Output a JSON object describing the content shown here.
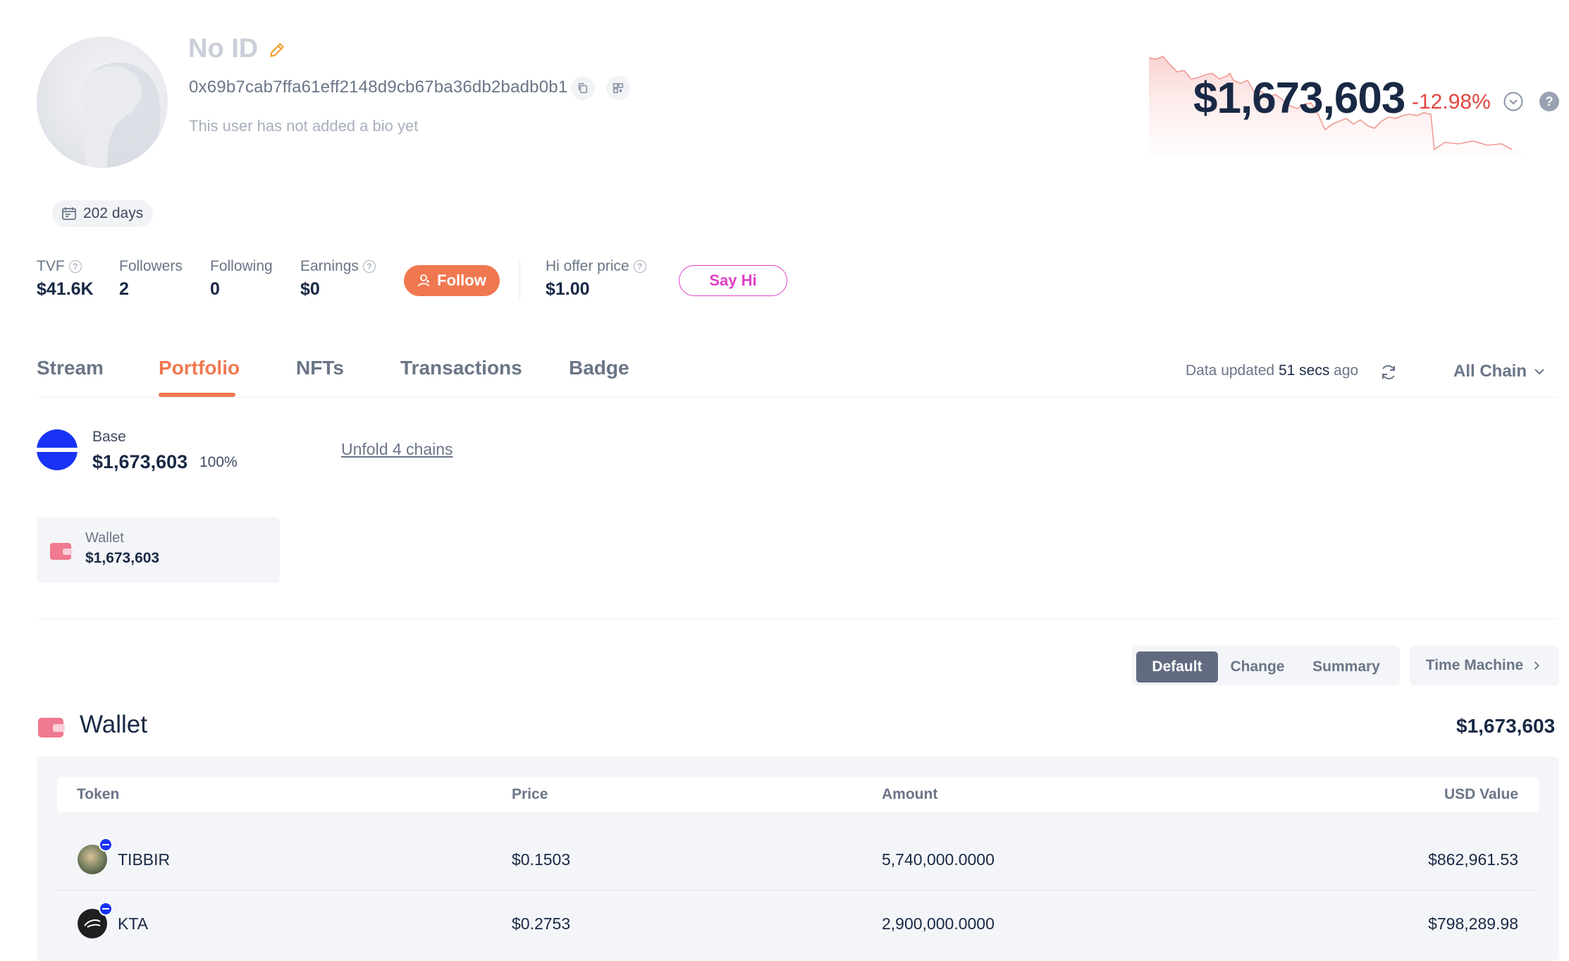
{
  "profile": {
    "name": "No ID",
    "address": "0x69b7cab7ffa61eff2148d9cb67ba36db2badb0b1",
    "bio": "This user has not added a bio yet",
    "days": "202 days"
  },
  "stats": {
    "tvf": {
      "label": "TVF",
      "value": "$41.6K"
    },
    "followers": {
      "label": "Followers",
      "value": "2"
    },
    "following": {
      "label": "Following",
      "value": "0"
    },
    "earnings": {
      "label": "Earnings",
      "value": "$0"
    },
    "follow_label": "Follow",
    "hi_offer": {
      "label": "Hi offer price",
      "value": "$1.00"
    },
    "sayhi_label": "Say Hi"
  },
  "balance": {
    "total": "$1,673,603",
    "change": "-12.98%",
    "colors": {
      "negative": "#e0453e"
    }
  },
  "tabs": [
    {
      "label": "Stream"
    },
    {
      "label": "Portfolio",
      "active": true
    },
    {
      "label": "NFTs"
    },
    {
      "label": "Transactions"
    },
    {
      "label": "Badge"
    }
  ],
  "status": {
    "prefix": "Data updated",
    "time": "51 secs",
    "suffix": "ago",
    "chain_filter": "All Chain"
  },
  "chain": {
    "name": "Base",
    "value": "$1,673,603",
    "percent": "100%",
    "unfold_label": "Unfold 4 chains"
  },
  "wallet_card": {
    "label": "Wallet",
    "value": "$1,673,603"
  },
  "view_modes": [
    {
      "label": "Default",
      "active": true
    },
    {
      "label": "Change"
    },
    {
      "label": "Summary"
    }
  ],
  "time_machine_label": "Time Machine",
  "wallet": {
    "title": "Wallet",
    "total": "$1,673,603",
    "columns": [
      "Token",
      "Price",
      "Amount",
      "USD Value"
    ],
    "rows": [
      {
        "token": "TIBBIR",
        "price": "$0.1503",
        "amount": "5,740,000.0000",
        "usd": "$862,961.53"
      },
      {
        "token": "KTA",
        "price": "$0.2753",
        "amount": "2,900,000.0000",
        "usd": "$798,289.98"
      }
    ]
  },
  "colors": {
    "accent": "#f07850",
    "sayhi": "#e040c8",
    "base_blue": "#1833f5"
  }
}
